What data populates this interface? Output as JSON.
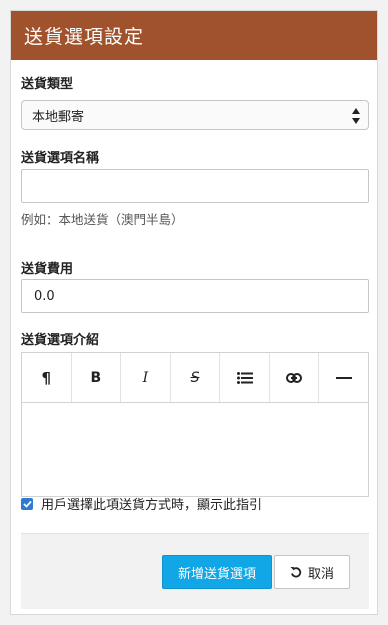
{
  "dialog": {
    "title": "送貨選項設定"
  },
  "shipping_type": {
    "label": "送貨類型",
    "selected": "本地郵寄"
  },
  "option_name": {
    "label": "送貨選項名稱",
    "value": "",
    "hint": "例如：本地送貨（澳門半島）"
  },
  "fee": {
    "label": "送貨費用",
    "value": "0.0"
  },
  "description": {
    "label": "送貨選項介紹",
    "toolbar": [
      {
        "name": "paragraph-icon",
        "glyph": "¶"
      },
      {
        "name": "bold-icon",
        "glyph": "B"
      },
      {
        "name": "italic-icon",
        "glyph": "I"
      },
      {
        "name": "strikethrough-icon",
        "glyph": "S"
      },
      {
        "name": "bullet-list-icon",
        "glyph": "list"
      },
      {
        "name": "link-icon",
        "glyph": "link"
      },
      {
        "name": "horizontal-rule-icon",
        "glyph": "—"
      }
    ],
    "content": ""
  },
  "show_instructions": {
    "checked": true,
    "label": "用戶選擇此項送貨方式時，顯示此指引"
  },
  "actions": {
    "add_label": "新增送貨選項",
    "cancel_label": "取消"
  },
  "colors": {
    "header": "#a0522d",
    "primary": "#11a6e6",
    "checkbox": "#2e7bcf"
  }
}
